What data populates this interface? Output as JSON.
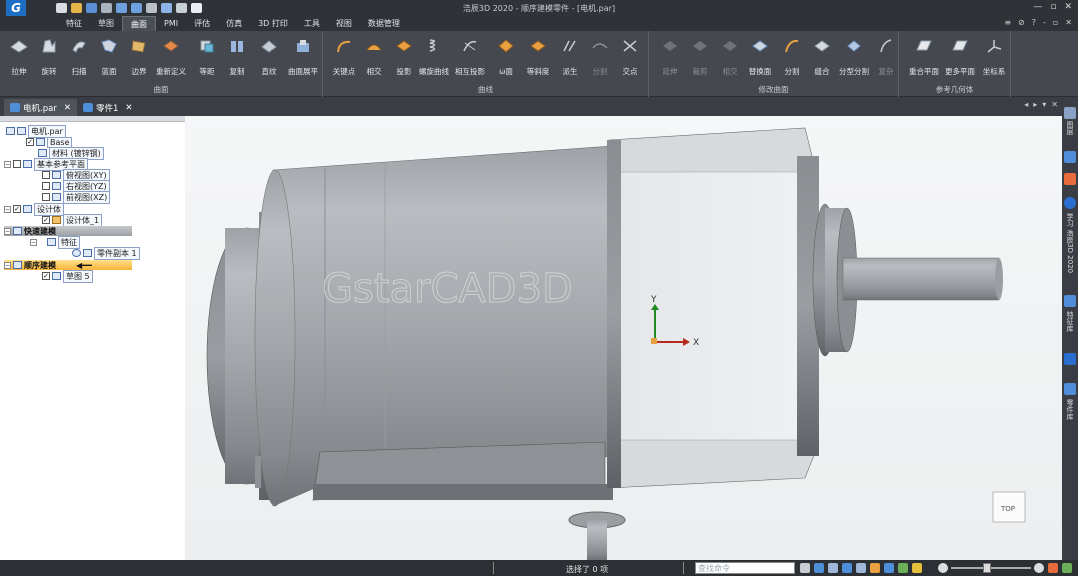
{
  "app": {
    "logo": "G",
    "window_title": "浩辰3D 2020 - 顺序建模零件 - [电机.par]",
    "window_controls": [
      "—",
      "▫",
      "✕"
    ]
  },
  "menu": {
    "tabs": [
      "特征",
      "草图",
      "曲面",
      "PMI",
      "评估",
      "仿真",
      "3D 打印",
      "工具",
      "视图",
      "数据管理"
    ],
    "active_tab": "曲面",
    "right_icons": [
      "≡",
      "⊘",
      "?",
      "-",
      "▫",
      "✕"
    ]
  },
  "ribbon": {
    "groups": [
      {
        "caption": "曲面",
        "tools": [
          "拉伸",
          "旋转",
          "扫描",
          "蓝面",
          "边界",
          "重新定义",
          "等距",
          "复制",
          "直纹",
          "曲面展平"
        ]
      },
      {
        "caption": "曲线",
        "tools": [
          "关键点",
          "相交",
          "投影",
          "螺旋曲线",
          "相互投影",
          "ω面",
          "等斜度",
          "派生",
          "分割",
          "交点"
        ]
      },
      {
        "caption": "修改曲面",
        "tools": [
          "延伸",
          "裁剪",
          "相交",
          "替换面",
          "分割",
          "缝合",
          "分型分割",
          "复杂"
        ]
      },
      {
        "caption": "参考几何体",
        "tools": [
          "重合平面",
          "更多平面",
          "坐标系"
        ]
      }
    ],
    "dim_tools": [
      "分割",
      "延伸",
      "裁剪",
      "相交",
      "复杂"
    ]
  },
  "doc_tabs": [
    {
      "label": "电机.par",
      "active": true
    },
    {
      "label": "零件1",
      "active": false
    }
  ],
  "tree": {
    "root": "电机.par",
    "base": "Base",
    "material": "材料 (镀锌钢)",
    "ref_planes": "基本参考平面",
    "plane_xy": "俯视图(XY)",
    "plane_yz": "右视图(YZ)",
    "plane_xz": "前视图(XZ)",
    "design_body": "设计体",
    "design_body_1": "设计体_1",
    "sync_modeling": "快速建模",
    "features": "特征",
    "part_copy": "零件副本 1",
    "ordered_modeling": "顺序建模",
    "sketch": "草图 5"
  },
  "viewport": {
    "watermark": "GstarCAD3D",
    "axis_y": "Y",
    "axis_x": "X",
    "view_cube": "TOP"
  },
  "right_panel": {
    "labels": [
      "图层",
      "学习 浩辰3D 2020",
      "特征库",
      "零件库"
    ]
  },
  "status": {
    "text": "选择了 0 项",
    "command_placeholder": "查找命令"
  }
}
